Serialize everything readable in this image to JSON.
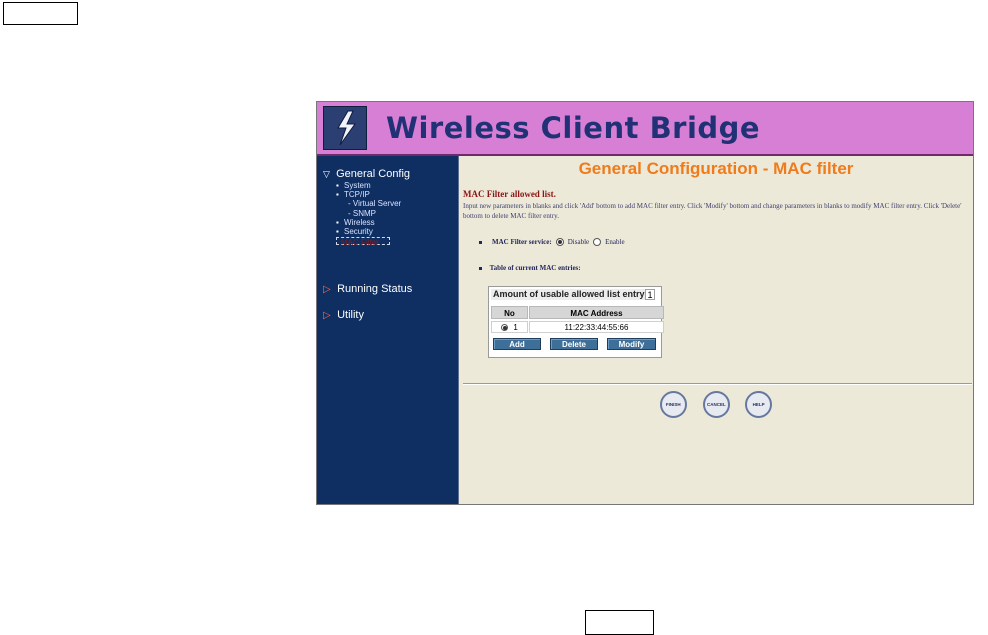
{
  "window": {
    "header_title": "Wireless Client Bridge"
  },
  "sidebar": {
    "general_config": "General Config",
    "subitems": [
      "System",
      "TCP/IP",
      "- Virtual Server",
      "- SNMP",
      "Wireless",
      "Security",
      "MAC Filter"
    ],
    "running_status": "Running Status",
    "utility": "Utility"
  },
  "content": {
    "title": "General Configuration - MAC filter",
    "section_title": "MAC Filter allowed list.",
    "description": "Input new parameters in blanks and click 'Add' bottom to add MAC filter entry. Click 'Modify' bottom and change parameters in blanks to modify MAC filter entry. Click 'Delete' bottom to delete MAC filter entry.",
    "mac_filter_service_label": "MAC Filter service:",
    "disable_label": "Disable",
    "enable_label": "Enable",
    "service_state": "Disable",
    "table_label": "Table of current MAC entries:",
    "amount_label": "Amount of usable allowed list entry",
    "amount_value": "1",
    "table_headers": [
      "No",
      "MAC Address"
    ],
    "rows": [
      {
        "no": "1",
        "mac": "11:22:33:44:55:66",
        "selected": true
      }
    ],
    "buttons": {
      "add": "Add",
      "delete": "Delete",
      "modify": "Modify"
    },
    "bottom_buttons": {
      "finish": "FINISH",
      "cancel": "CANCEL",
      "help": "HELP"
    }
  },
  "colors": {
    "banner": "#d77fd4",
    "sidebar": "#0f2f63",
    "title": "#ef7b1b",
    "button_blue": "#3d6f98"
  }
}
